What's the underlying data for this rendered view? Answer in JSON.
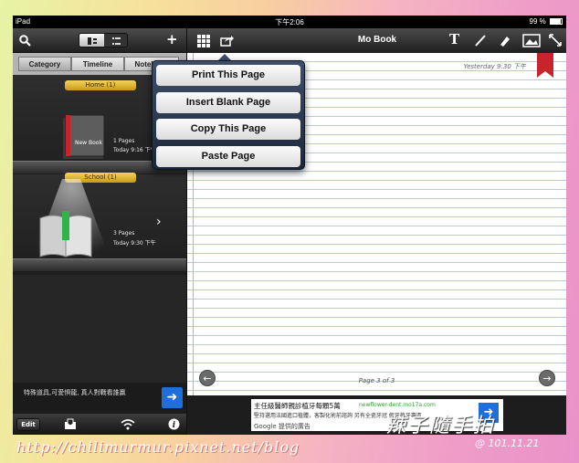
{
  "status_bar": {
    "device": "iPad",
    "time": "下午2:06",
    "battery": "99 %"
  },
  "left_panel": {
    "tabs": [
      "Category",
      "Timeline",
      "Notebook"
    ],
    "shelves": [
      {
        "label": "Home (1)",
        "book_title": "New Book",
        "pages": "1 Pages",
        "date": "Today 9:16 下午"
      },
      {
        "label": "School (1)",
        "pages": "3 Pages",
        "date": "Today 9:30 下午"
      }
    ],
    "promo_text": "特殊道具,可愛惧龍, 真人對戰看誰贏",
    "edit_label": "Edit"
  },
  "right_panel": {
    "title": "Mo Book",
    "paper_date": "Yesterday 9:30 下午",
    "page_indicator": "Page 3 of 3"
  },
  "popover": {
    "items": [
      "Print This Page",
      "Insert Blank Page",
      "Copy This Page",
      "Paste Page"
    ]
  },
  "ad": {
    "title": "主任級醫師親診植牙每顆5萬",
    "url": "newflower-dent.mo17a.com",
    "desc": "堅持選用法國進口植體，客製化術前諮詢 另有全瓷牙冠 假牙植牙專區...",
    "google": "Google 提供的廣告"
  },
  "watermark": {
    "url": "http://chilimurmur.pixnet.net/blog",
    "signature": "辣子隨手拍",
    "date": "@ 101.11.21"
  },
  "colors": {
    "accent_blue": "#1e6fd9",
    "bookmark_red": "#c8242b",
    "shelf_label": "#e8b930"
  }
}
